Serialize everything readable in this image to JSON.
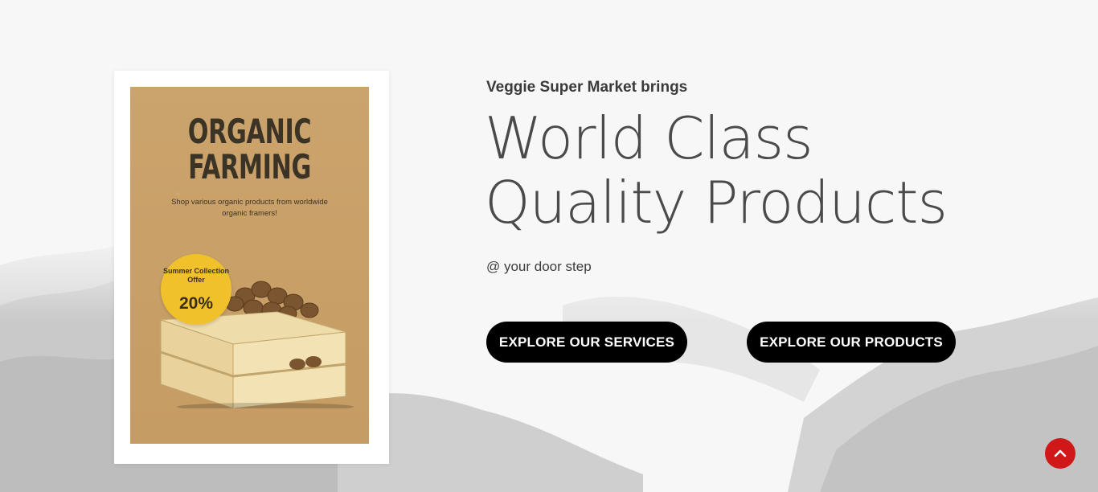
{
  "poster": {
    "title": "ORGANIC FARMING",
    "subtitle": "Shop various organic products from worldwide organic framers!",
    "badge_text": "Summer Collection Offer",
    "badge_percent": "20%",
    "colors": {
      "paper": "#c9a068",
      "badge": "#f1c12b",
      "title": "#3b3326"
    },
    "image_icon": "wooden-crate-with-walnuts"
  },
  "hero": {
    "kicker": "Veggie Super Market brings",
    "headline_line1": "World Class",
    "headline_line2": "Quality Products",
    "tagline": "@ your door step"
  },
  "buttons": {
    "services": "EXPLORE OUR SERVICES",
    "products": "EXPLORE OUR PRODUCTS"
  },
  "scroll_top": {
    "icon": "chevron-up-icon",
    "color": "#d01818"
  }
}
